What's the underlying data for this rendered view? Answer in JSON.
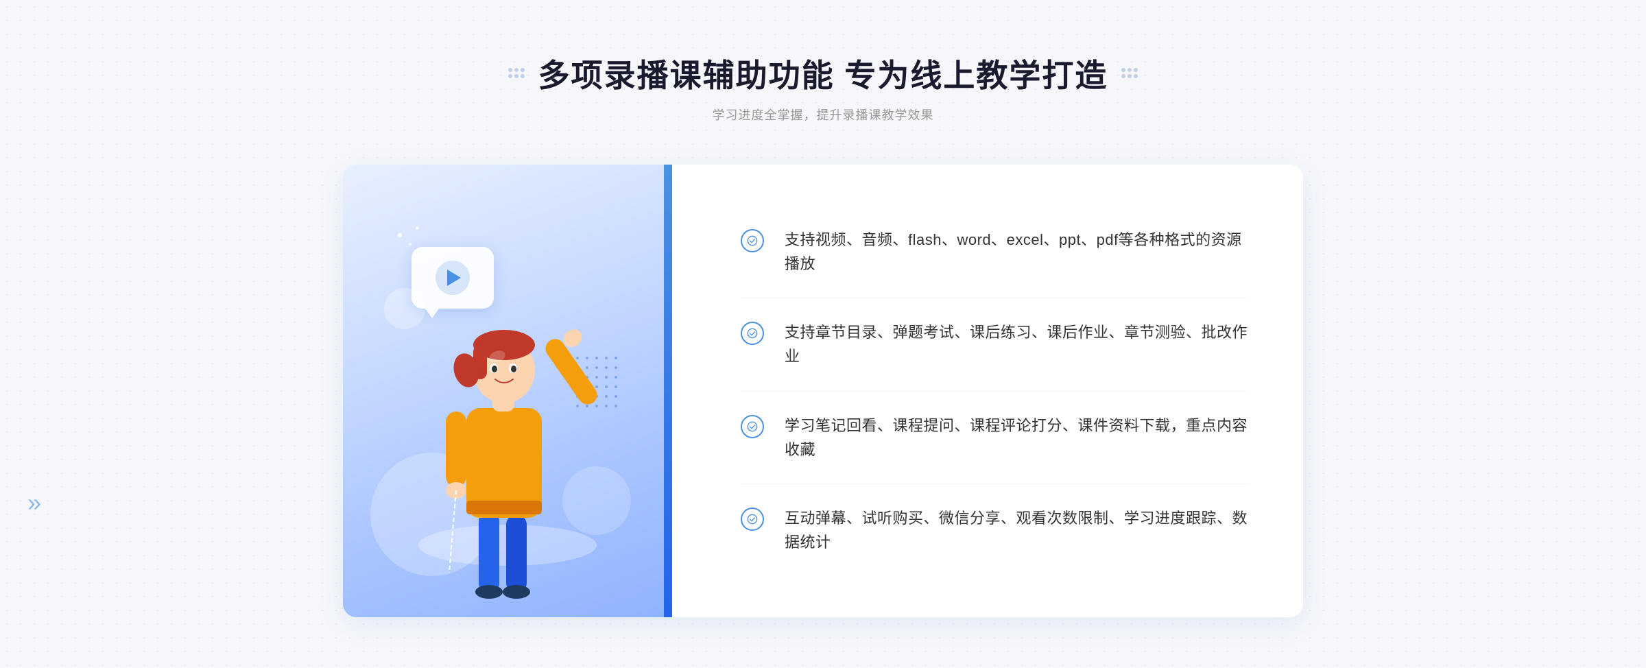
{
  "header": {
    "title": "多项录播课辅助功能 专为线上教学打造",
    "subtitle": "学习进度全掌握，提升录播课教学效果"
  },
  "features": [
    {
      "id": 1,
      "text": "支持视频、音频、flash、word、excel、ppt、pdf等各种格式的资源播放"
    },
    {
      "id": 2,
      "text": "支持章节目录、弹题考试、课后练习、课后作业、章节测验、批改作业"
    },
    {
      "id": 3,
      "text": "学习笔记回看、课程提问、课程评论打分、课件资料下载，重点内容收藏"
    },
    {
      "id": 4,
      "text": "互动弹幕、试听购买、微信分享、观看次数限制、学习进度跟踪、数据统计"
    }
  ],
  "decorative": {
    "dot_grid_label": "decorative dots",
    "check_icon_label": "check circle icon"
  }
}
